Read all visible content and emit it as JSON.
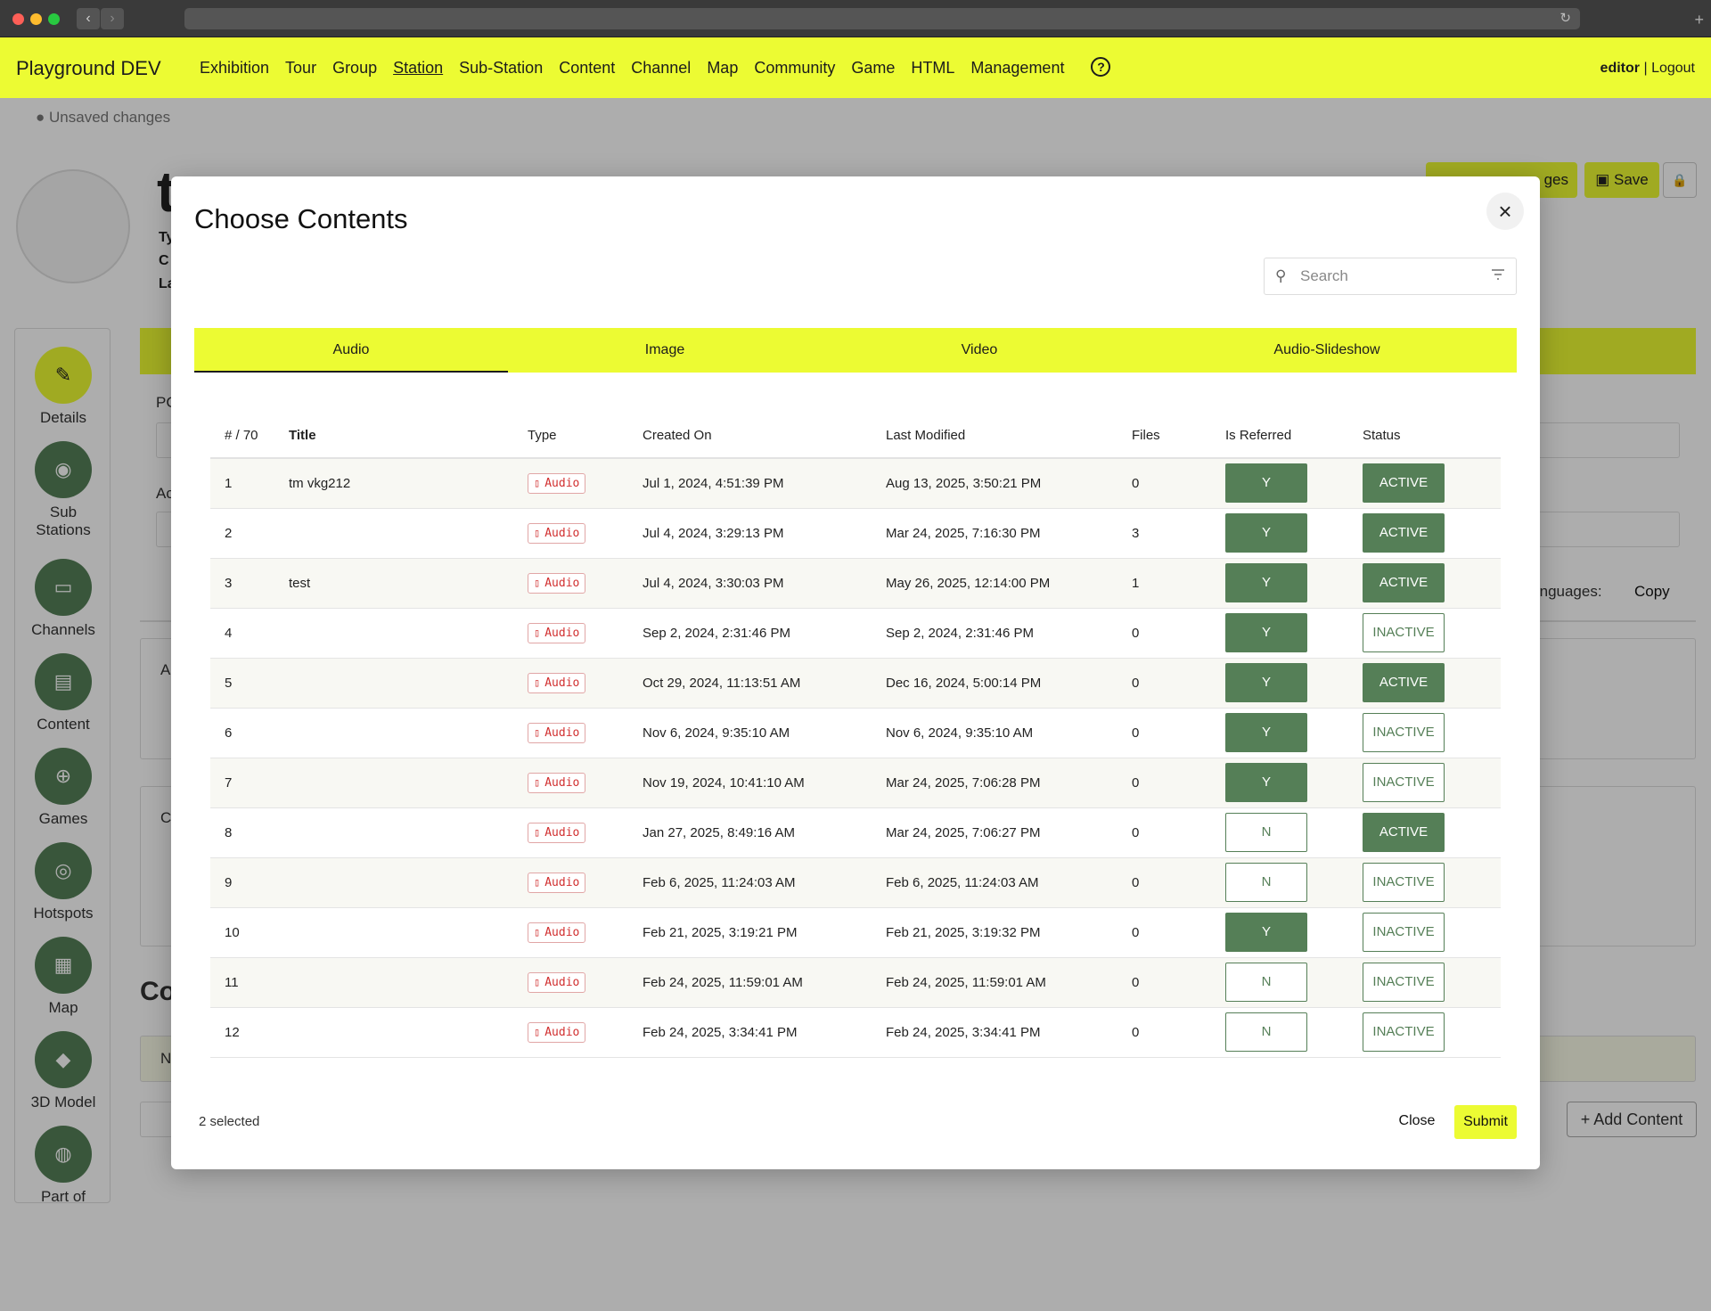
{
  "app": {
    "brand": "Playground DEV",
    "nav": [
      "Exhibition",
      "Tour",
      "Group",
      "Station",
      "Sub-Station",
      "Content",
      "Channel",
      "Map",
      "Community",
      "Game",
      "HTML",
      "Management"
    ],
    "active_nav": "Station",
    "help_glyph": "?",
    "user": "editor",
    "separator": "|",
    "logout": "Logout"
  },
  "background": {
    "unsaved": "Unsaved changes",
    "title": "t",
    "type_label": "Ty",
    "c_label": "C",
    "la_label": "La",
    "save_label": "Save",
    "reset_label": "ges",
    "po_label": "PC",
    "ac_label": "Ac",
    "languages_label": "r languages:",
    "copy_label": "Copy",
    "a_label": "A",
    "c2_label": "C",
    "co_heading": "Co",
    "n_label": "N",
    "add_content_label": "Add Content",
    "sidebar": [
      {
        "label": "Details",
        "icon": "edit-icon"
      },
      {
        "label": "Sub\nStations",
        "icon": "target-icon"
      },
      {
        "label": "Channels",
        "icon": "monitor-icon"
      },
      {
        "label": "Content",
        "icon": "document-icon"
      },
      {
        "label": "Games",
        "icon": "gamepad-icon"
      },
      {
        "label": "Hotspots",
        "icon": "hotspot-icon"
      },
      {
        "label": "Map",
        "icon": "map-icon"
      },
      {
        "label": "3D Model",
        "icon": "cube-icon"
      },
      {
        "label": "Part of",
        "icon": "compass-icon"
      }
    ]
  },
  "modal": {
    "title": "Choose Contents",
    "search_placeholder": "Search",
    "tabs": [
      "Audio",
      "Image",
      "Video",
      "Audio-Slideshow"
    ],
    "active_tab": "Audio",
    "columns": {
      "index": "# / 70",
      "title": "Title",
      "type": "Type",
      "created": "Created On",
      "modified": "Last Modified",
      "files": "Files",
      "referred": "Is Referred",
      "status": "Status"
    },
    "rows": [
      {
        "n": "1",
        "title": "tm vkg212",
        "type": "Audio",
        "created": "Jul 1, 2024, 4:51:39 PM",
        "modified": "Aug 13, 2025, 3:50:21 PM",
        "files": "0",
        "referred": "Y",
        "status": "ACTIVE"
      },
      {
        "n": "2",
        "title": "",
        "type": "Audio",
        "created": "Jul 4, 2024, 3:29:13 PM",
        "modified": "Mar 24, 2025, 7:16:30 PM",
        "files": "3",
        "referred": "Y",
        "status": "ACTIVE"
      },
      {
        "n": "3",
        "title": "test",
        "type": "Audio",
        "created": "Jul 4, 2024, 3:30:03 PM",
        "modified": "May 26, 2025, 12:14:00 PM",
        "files": "1",
        "referred": "Y",
        "status": "ACTIVE"
      },
      {
        "n": "4",
        "title": "",
        "type": "Audio",
        "created": "Sep 2, 2024, 2:31:46 PM",
        "modified": "Sep 2, 2024, 2:31:46 PM",
        "files": "0",
        "referred": "Y",
        "status": "INACTIVE"
      },
      {
        "n": "5",
        "title": "",
        "type": "Audio",
        "created": "Oct 29, 2024, 11:13:51 AM",
        "modified": "Dec 16, 2024, 5:00:14 PM",
        "files": "0",
        "referred": "Y",
        "status": "ACTIVE"
      },
      {
        "n": "6",
        "title": "",
        "type": "Audio",
        "created": "Nov 6, 2024, 9:35:10 AM",
        "modified": "Nov 6, 2024, 9:35:10 AM",
        "files": "0",
        "referred": "Y",
        "status": "INACTIVE"
      },
      {
        "n": "7",
        "title": "",
        "type": "Audio",
        "created": "Nov 19, 2024, 10:41:10 AM",
        "modified": "Mar 24, 2025, 7:06:28 PM",
        "files": "0",
        "referred": "Y",
        "status": "INACTIVE"
      },
      {
        "n": "8",
        "title": "",
        "type": "Audio",
        "created": "Jan 27, 2025, 8:49:16 AM",
        "modified": "Mar 24, 2025, 7:06:27 PM",
        "files": "0",
        "referred": "N",
        "status": "ACTIVE"
      },
      {
        "n": "9",
        "title": "",
        "type": "Audio",
        "created": "Feb 6, 2025, 11:24:03 AM",
        "modified": "Feb 6, 2025, 11:24:03 AM",
        "files": "0",
        "referred": "N",
        "status": "INACTIVE"
      },
      {
        "n": "10",
        "title": "",
        "type": "Audio",
        "created": "Feb 21, 2025, 3:19:21 PM",
        "modified": "Feb 21, 2025, 3:19:32 PM",
        "files": "0",
        "referred": "Y",
        "status": "INACTIVE"
      },
      {
        "n": "11",
        "title": "",
        "type": "Audio",
        "created": "Feb 24, 2025, 11:59:01 AM",
        "modified": "Feb 24, 2025, 11:59:01 AM",
        "files": "0",
        "referred": "N",
        "status": "INACTIVE"
      },
      {
        "n": "12",
        "title": "",
        "type": "Audio",
        "created": "Feb 24, 2025, 3:34:41 PM",
        "modified": "Feb 24, 2025, 3:34:41 PM",
        "files": "0",
        "referred": "N",
        "status": "INACTIVE"
      }
    ],
    "selected_count": "2 selected",
    "close_label": "Close",
    "submit_label": "Submit"
  },
  "colors": {
    "accent_yellow": "#ecfb33",
    "green": "#557f57",
    "audio_red": "#d12f2f"
  }
}
